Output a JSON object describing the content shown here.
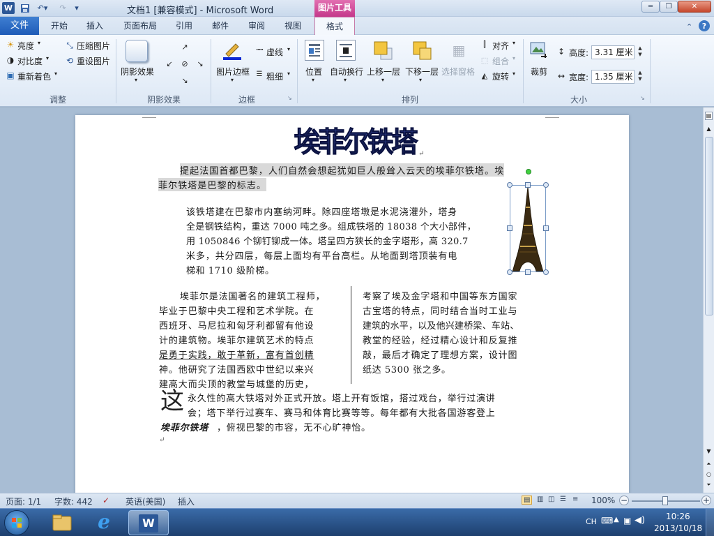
{
  "titlebar": {
    "title": "文档1 [兼容模式] - Microsoft Word",
    "contextual_tab": "图片工具"
  },
  "tabs": [
    "文件",
    "开始",
    "插入",
    "页面布局",
    "引用",
    "邮件",
    "审阅",
    "视图",
    "格式"
  ],
  "ribbon": {
    "adjust": {
      "brightness": "亮度",
      "contrast": "对比度",
      "recolor": "重新着色",
      "compress": "压缩图片",
      "reset": "重设图片",
      "label": "调整"
    },
    "shadow": {
      "shadow_effects": "阴影效果",
      "label": "阴影效果"
    },
    "border": {
      "picture_border": "图片边框",
      "dashes": "虚线",
      "weight": "粗细",
      "label": "边框"
    },
    "arrange": {
      "position": "位置",
      "wrap": "自动换行",
      "bring_forward": "上移一层",
      "send_backward": "下移一层",
      "selection_pane": "选择窗格",
      "align": "对齐",
      "group": "组合",
      "rotate": "旋转",
      "label": "排列"
    },
    "size": {
      "crop": "裁剪",
      "height_label": "高度:",
      "height_value": "3.31 厘米",
      "width_label": "宽度:",
      "width_value": "1.35 厘米",
      "label": "大小"
    }
  },
  "document": {
    "wordart_title": "埃菲尔铁塔",
    "para1_line1": "提起法国首都巴黎，人们自然会想起犹如巨人般耸入云天的埃菲尔铁塔。埃",
    "para1_line2": "菲尔铁塔是巴黎的标志。",
    "para2_lines": [
      "该铁塔建在巴黎市内塞纳河畔。除四座塔墩是水泥浇灌外，塔身",
      "全是钢铁结构，重达 7000 吨之多。组成铁塔的 18038 个大小部件，",
      "用 1050846 个铆钉铆成一体。塔呈四方狭长的金字塔形，高 320.7",
      "米多，共分四层，每层上面均有平台高栏。从地面到塔顶装有电",
      "梯和 1710 级阶梯。"
    ],
    "col1_lines": [
      "埃菲尔是法国著名的建筑工程师，",
      "毕业于巴黎中央工程和艺术学院。在",
      "西班牙、马尼拉和匈牙利都留有他设",
      "计的建筑物。埃菲尔建筑艺术的特点",
      "是勇于实践，敢于革新，富有首创精",
      "神。他研究了法国西欧中世纪以来兴",
      "建高大而尖顶的教堂与城堡的历史，"
    ],
    "col2_lines": [
      "考察了埃及金字塔和中国等东方国家",
      "古宝塔的特点，同时结合当时工业与",
      "建筑的水平，以及他兴建桥梁、车站、",
      "教堂的经验，经过精心设计和反复推",
      "敲，最后才确定了理想方案，设计图",
      "纸达 5300 张之多。"
    ],
    "dropcap": "这",
    "last_line1": "永久性的高大铁塔对外正式开放。塔上开有饭馆，搭过戏台，举行过演讲",
    "last_line2": "会；塔下举行过赛车、赛马和体育比赛等等。每年都有大批各国游客登上",
    "last_line3_bold": "埃菲尔铁塔",
    "last_line3_rest": "，俯视巴黎的市容，无不心旷神怡。"
  },
  "statusbar": {
    "page": "页面: 1/1",
    "words": "字数: 442",
    "language": "英语(美国)",
    "mode": "插入",
    "zoom": "100%"
  },
  "taskbar": {
    "ime": "CH",
    "time": "10:26",
    "date": "2013/10/18"
  },
  "colors": {
    "accent": "#1e5bb8",
    "contextual": "#c4388a",
    "wordart": "#1c2a6b"
  }
}
